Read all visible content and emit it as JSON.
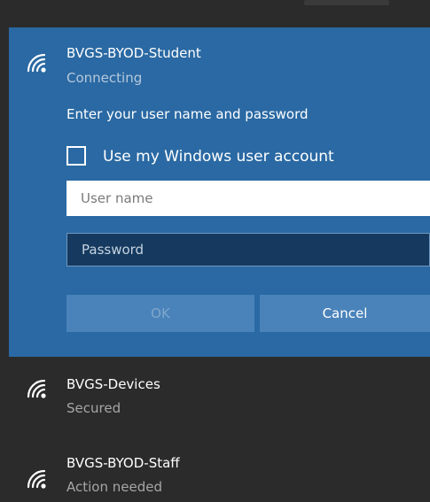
{
  "selected_network": {
    "name": "BVGS-BYOD-Student",
    "status": "Connecting",
    "icon": "wifi-signal-icon",
    "prompt": "Enter your user name and password",
    "checkbox_label": "Use my Windows user account",
    "checkbox_checked": false,
    "username_placeholder": "User name",
    "password_placeholder": "Password",
    "ok_label": "OK",
    "cancel_label": "Cancel"
  },
  "networks": [
    {
      "name": "BVGS-Devices",
      "status": "Secured",
      "icon": "wifi-signal-icon"
    },
    {
      "name": "BVGS-BYOD-Staff",
      "status": "Action needed",
      "icon": "wifi-signal-icon"
    }
  ],
  "colors": {
    "panel_background": "#2b2b2b",
    "selected_background": "#2a69a3",
    "button_background": "#4a83ba",
    "text_primary": "#ffffff",
    "text_secondary": "#b7c9dd"
  }
}
